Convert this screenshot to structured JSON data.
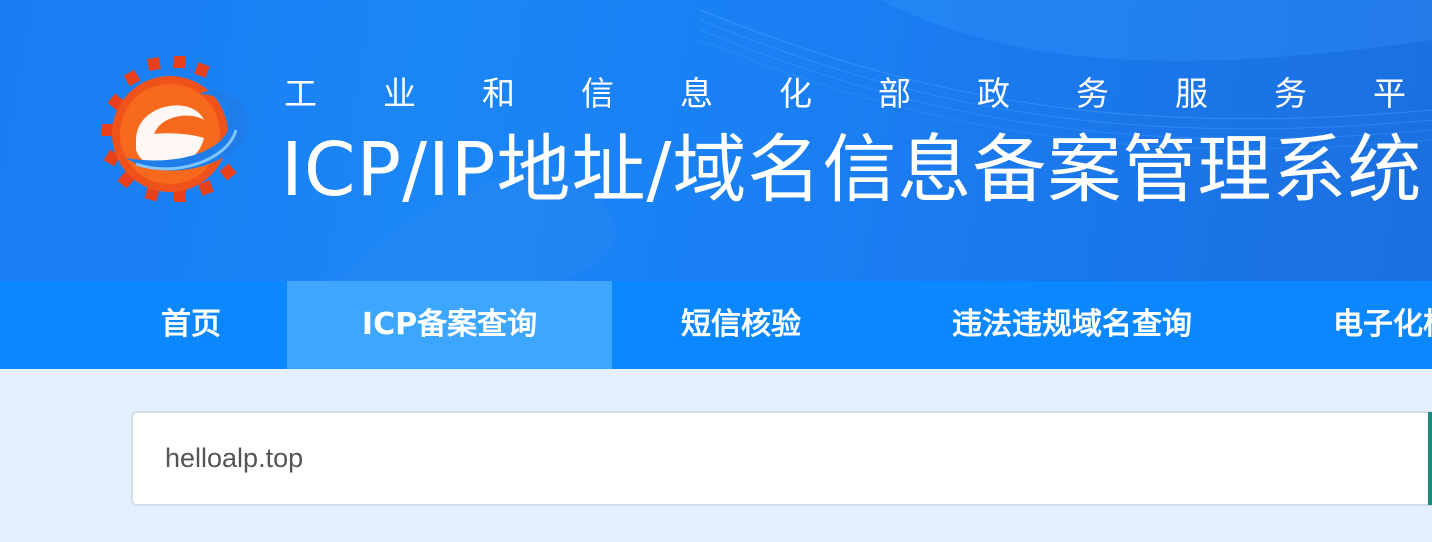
{
  "header": {
    "subtitle": "工业和信息化部政务服务平台",
    "title": "ICP/IP地址/域名信息备案管理系统",
    "colors": {
      "background": "#1a7cf2",
      "logo_orange": "#f2551c",
      "logo_blue": "#1e7de8"
    }
  },
  "nav": {
    "items": [
      {
        "label": "首页",
        "active": false
      },
      {
        "label": "ICP备案查询",
        "active": true
      },
      {
        "label": "短信核验",
        "active": false
      },
      {
        "label": "违法违规域名查询",
        "active": false
      },
      {
        "label": "电子化核验",
        "active": false
      }
    ],
    "colors": {
      "bar": "#0b88ff",
      "active": "#3da6ff"
    }
  },
  "search": {
    "value": "helloalp.top"
  }
}
